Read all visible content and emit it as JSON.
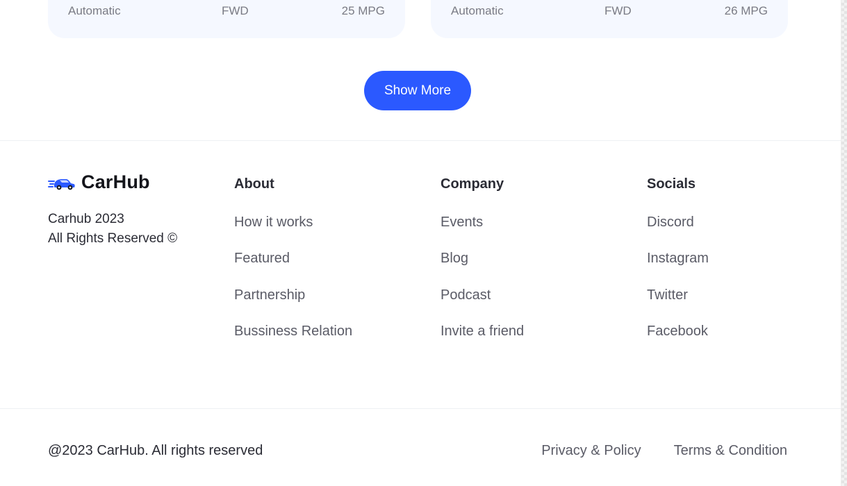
{
  "cards": [
    {
      "specs": [
        "Automatic",
        "FWD",
        "25 MPG"
      ]
    },
    {
      "specs": [
        "Automatic",
        "FWD",
        "26 MPG"
      ]
    }
  ],
  "show_more_label": "Show More",
  "footer": {
    "brand": {
      "name": "CarHub",
      "icon": "car-logo-icon",
      "color": "#2b59ff"
    },
    "copyright_lines": [
      "Carhub 2023",
      "All Rights Reserved ©"
    ],
    "columns": [
      {
        "title": "About",
        "links": [
          "How it works",
          "Featured",
          "Partnership",
          "Bussiness Relation"
        ]
      },
      {
        "title": "Company",
        "links": [
          "Events",
          "Blog",
          "Podcast",
          "Invite a friend"
        ]
      },
      {
        "title": "Socials",
        "links": [
          "Discord",
          "Instagram",
          "Twitter",
          "Facebook"
        ]
      }
    ],
    "bottom": {
      "rights": "@2023 CarHub. All rights reserved",
      "links": [
        "Privacy & Policy",
        "Terms & Condition"
      ]
    }
  },
  "colors": {
    "accent": "#2b59ff",
    "card_bg": "#f5f8ff",
    "text_primary": "#2b2c35",
    "text_muted": "#5a5b66"
  }
}
